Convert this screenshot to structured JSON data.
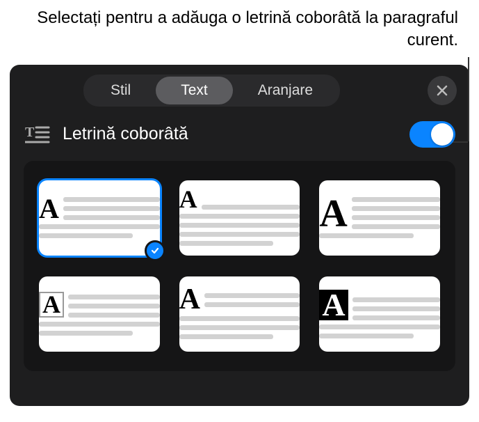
{
  "callout": {
    "text": "Selectați pentru a adăuga o letrină coborâtă la paragraful curent."
  },
  "tabs": {
    "style": "Stil",
    "text": "Text",
    "arrange": "Aranjare"
  },
  "section": {
    "title": "Letrină coborâtă",
    "toggle_on": true
  },
  "dropcap_styles": [
    {
      "id": "style-1",
      "selected": true,
      "variant": "classic-2line"
    },
    {
      "id": "style-2",
      "selected": false,
      "variant": "raised-2line"
    },
    {
      "id": "style-3",
      "selected": false,
      "variant": "large-3line"
    },
    {
      "id": "style-4",
      "selected": false,
      "variant": "boxed-2line"
    },
    {
      "id": "style-5",
      "selected": false,
      "variant": "centered-2line"
    },
    {
      "id": "style-6",
      "selected": false,
      "variant": "inverse-block"
    }
  ],
  "icons": {
    "close": "close-icon",
    "dropcap_section": "dropcap-section-icon",
    "check": "checkmark-icon"
  },
  "glyph": {
    "letter": "A"
  }
}
